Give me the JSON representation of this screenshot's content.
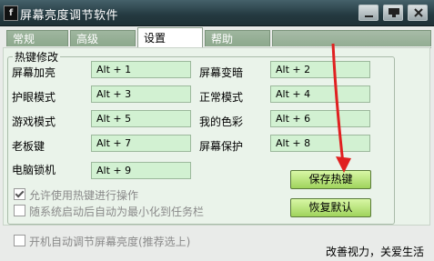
{
  "window": {
    "title": "屏幕亮度调节软件"
  },
  "tabs": [
    {
      "label": "常规"
    },
    {
      "label": "高级"
    },
    {
      "label": "设置"
    },
    {
      "label": "帮助"
    }
  ],
  "hotkeys": {
    "group_title": "热键修改",
    "items": [
      {
        "label": "屏幕加亮",
        "value": "Alt + 1"
      },
      {
        "label": "屏幕变暗",
        "value": "Alt + 2"
      },
      {
        "label": "护眼模式",
        "value": "Alt + 3"
      },
      {
        "label": "正常模式",
        "value": "Alt + 4"
      },
      {
        "label": "游戏模式",
        "value": "Alt + 5"
      },
      {
        "label": "我的色彩",
        "value": "Alt + 6"
      },
      {
        "label": "老板键",
        "value": "Alt + 7"
      },
      {
        "label": "屏幕保护",
        "value": "Alt + 8"
      },
      {
        "label": "电脑锁机",
        "value": "Alt + 9"
      }
    ],
    "save_label": "保存热键",
    "reset_label": "恢复默认",
    "allow_hotkey_label": "允许使用热键进行操作",
    "allow_hotkey_checked": true,
    "minimize_on_start_label": "随系统启动后自动为最小化到任务栏",
    "minimize_on_start_checked": false
  },
  "footer": {
    "autostart_label": "开机自动调节屏幕亮度(推荐选上)",
    "autostart_checked": false,
    "slogan": "改善视力，关爱生活"
  },
  "colors": {
    "titlebar": "#243940",
    "field": "#d2f1d2",
    "button": "#b9e47e",
    "arrow": "#e02020"
  },
  "icons": {
    "minimize": "minimize-icon",
    "help": "help-icon",
    "close": "close-icon",
    "app": "app-icon"
  }
}
